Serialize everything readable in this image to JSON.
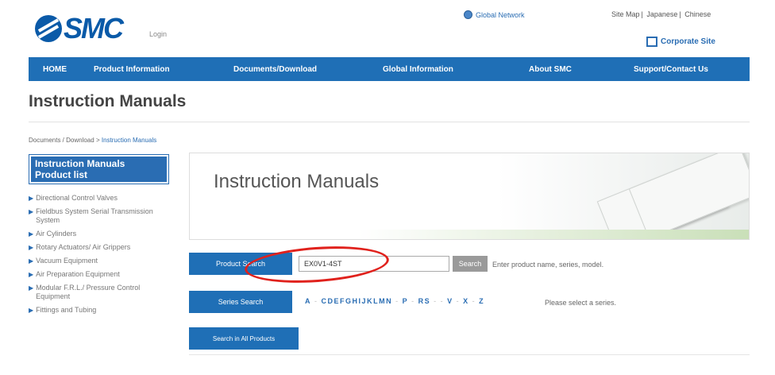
{
  "header": {
    "logo_text": "SMC",
    "login_label": "Login",
    "global_network_label": "Global Network",
    "top_links": [
      "Site Map",
      "Japanese",
      "Chinese"
    ],
    "corporate_site_label": "Corporate Site"
  },
  "nav": {
    "items": [
      {
        "label": "HOME"
      },
      {
        "label": "Product Information"
      },
      {
        "label": "Documents/Download"
      },
      {
        "label": "Global Information"
      },
      {
        "label": "About SMC"
      },
      {
        "label": "Support/Contact Us"
      }
    ]
  },
  "page": {
    "title": "Instruction Manuals",
    "breadcrumb": {
      "parent": "Documents / Download",
      "separator": ">",
      "current": "Instruction Manuals"
    }
  },
  "sidebar": {
    "heading": "Instruction Manuals Product list",
    "items": [
      {
        "label": "Directional Control Valves"
      },
      {
        "label": "Fieldbus System Serial Transmission System"
      },
      {
        "label": "Air Cylinders"
      },
      {
        "label": "Rotary Actuators/ Air Grippers"
      },
      {
        "label": "Vacuum Equipment"
      },
      {
        "label": "Air Preparation Equipment"
      },
      {
        "label": "Modular F.R.L./ Pressure Control Equipment"
      },
      {
        "label": "Fittings and Tubing"
      }
    ]
  },
  "banner": {
    "title": "Instruction Manuals"
  },
  "product_search": {
    "label": "Product Search",
    "value": "EX0V1-4ST",
    "button_label": "Search",
    "hint": "Enter product name, series, model."
  },
  "series_search": {
    "label": "Series Search",
    "letters": [
      "A",
      "C",
      "D",
      "E",
      "F",
      "G",
      "H",
      "I",
      "J",
      "K",
      "L",
      "M",
      "N",
      "P",
      "R",
      "S",
      "V",
      "X",
      "Z"
    ],
    "hint": "Please select a series."
  },
  "all_products": {
    "label": "Search in All Products"
  },
  "colors": {
    "nav_blue": "#1f6fb6",
    "annotation_red": "#e0211c"
  }
}
